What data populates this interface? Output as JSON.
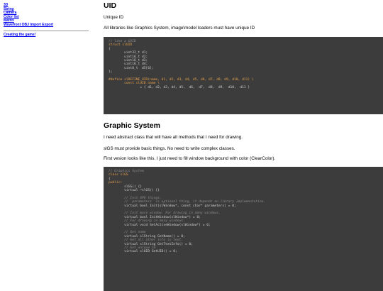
{
  "sidebar": {
    "links": [
      "3D",
      "String",
      "Camera",
      "Color list",
      "Matrix",
      "Wavefront OBJ Import Export"
    ],
    "game_link": "Creating the game!"
  },
  "sections": {
    "uid": {
      "heading": "UID",
      "p1": "Unique ID",
      "p2": "All libraries like Graphics System, image\\model loaders must have unique ID",
      "code": [
        "// like a GUID",
        "struct slUID",
        "{",
        "        uint32_t d1;",
        "        uint16_t d2;",
        "        uint16_t d3;",
        "        uint16_t d4;",
        "        uint8_t  d5[6];",
        "};",
        "",
        "#define slDEFINE_UID(name, d1, d2, d3, d4, d5, d6, d7, d8, d9, d10, d11) \\",
        "        const slUID name \\",
        "                = { d1, d2, d3, d4, d5,  d6,  d7,  d8,  d9,  d10,  d11 }"
      ]
    },
    "graphics": {
      "heading": "Graphic System",
      "p1": "I need abstract class that will have all methods that I need for drawing.",
      "p2": "slGS must provide basic things. No need to write complex classes.",
      "p3": "First vesion looks like this. I just need to fill window background with color (ClearColor).",
      "code": [
        "// Graphics System",
        "class slGS",
        "{",
        "public:",
        "        slGS() {}",
        "        virtual ~slGS() {}",
        "",
        "        // Init GPU things.",
        "        // `parameters` is optional thing, it depends on library implementation.",
        "        virtual bool Init(slWindow*, const char* parameters) = 0;",
        "",
        "        // Init more window. For drawing in many windows.",
        "        virtual bool InitWindow(slWindow*) = 0;",
        "        // For drawing in many windows.",
        "        virtual void SetActiveWindow(slWindow*) = 0;",
        "",
        "        // Get name",
        "        virtual slString GetName() = 0;",
        "        // Get all other info in text.",
        "        virtual slString GetTextInfo() = 0;",
        "        // Get unique ID",
        "        virtual slUID GetUID() = 0;"
      ]
    }
  },
  "colors": {
    "code_bg": "#3c3c3c",
    "code_text": "#d0d0d0",
    "comment": "#8c8c8c",
    "keyword": "#e8a24a",
    "link": "#0000ee"
  }
}
